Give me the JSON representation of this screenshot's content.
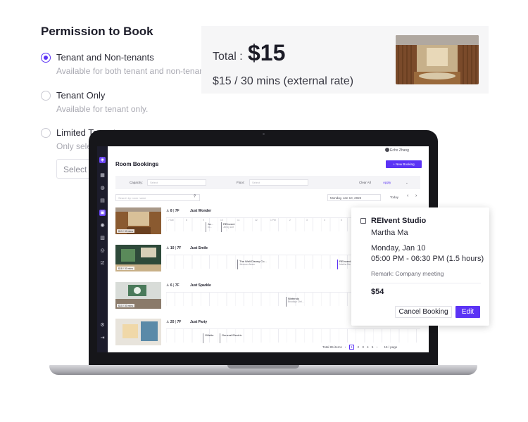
{
  "permission": {
    "title": "Permission to Book",
    "options": [
      {
        "label": "Tenant and Non-tenants",
        "desc": "Available for both tenant and non-tenant",
        "selected": true
      },
      {
        "label": "Tenant Only",
        "desc": "Available for tenant only.",
        "selected": false
      },
      {
        "label": "Limited Tenants",
        "desc": "Only selected tenants",
        "selected": false
      }
    ],
    "select_placeholder": "Select"
  },
  "price": {
    "total_label": "Total :",
    "total_amount": "$15",
    "rate": "$15 / 30 mins (external rate)"
  },
  "app": {
    "user_name": "Echo Zhang",
    "title": "Room Bookings",
    "new_booking": "+ New Booking",
    "filters": {
      "capacity_label": "Capacity:",
      "capacity_placeholder": "Select",
      "floor_label": "Floor:",
      "floor_placeholder": "Select",
      "clear_all": "Clear All",
      "apply": "Apply"
    },
    "search_placeholder": "Search by room name",
    "date": "Monday, Jan 10, 2022",
    "today": "Today",
    "hours": [
      "7 AM",
      "8",
      "9",
      "10",
      "11",
      "12",
      "1 PM",
      "2",
      "3",
      "4",
      "5",
      "6"
    ],
    "rooms": [
      {
        "rate": "$13 / 30 mins",
        "capacity": "8",
        "floor": "7F",
        "name": "Just Wonder",
        "events": [
          {
            "title": "Ja...",
            "sub": "Gi..."
          },
          {
            "title": "REInvent",
            "sub": "Jenny Lee"
          }
        ]
      },
      {
        "rate": "$18 / 30 mins",
        "capacity": "10",
        "floor": "7F",
        "name": "Just Smile",
        "events": [
          {
            "title": "The Walt Disney Co...",
            "sub": "Johnson Adam"
          },
          {
            "title": "REInvent",
            "sub": "Martha Ma"
          }
        ]
      },
      {
        "rate": "$10 / 30 mins",
        "capacity": "6",
        "floor": "7F",
        "name": "Just Sparkle",
        "events": [
          {
            "title": "Nintendo",
            "sub": "Brooklyn Chri..."
          }
        ]
      },
      {
        "rate": "",
        "capacity": "20",
        "floor": "7F",
        "name": "Just Party",
        "events": [
          {
            "title": "Gillette",
            "sub": ""
          },
          {
            "title": "General Electric",
            "sub": ""
          }
        ]
      }
    ],
    "pager": {
      "total": "Total 85 items",
      "pages": [
        "1",
        "2",
        "3",
        "4",
        "5"
      ],
      "per_page": "15 / page"
    }
  },
  "popup": {
    "studio": "REIvent Studio",
    "person": "Martha Ma",
    "date": "Monday, Jan 10",
    "time": "05:00 PM - 06:30 PM (1.5 hours)",
    "remark": "Remark: Company meeting",
    "amount": "$54",
    "cancel_label": "Cancel Booking",
    "edit_label": "Edit"
  },
  "colors": {
    "accent": "#5b33f5",
    "sidebar": "#1c1c2b"
  }
}
